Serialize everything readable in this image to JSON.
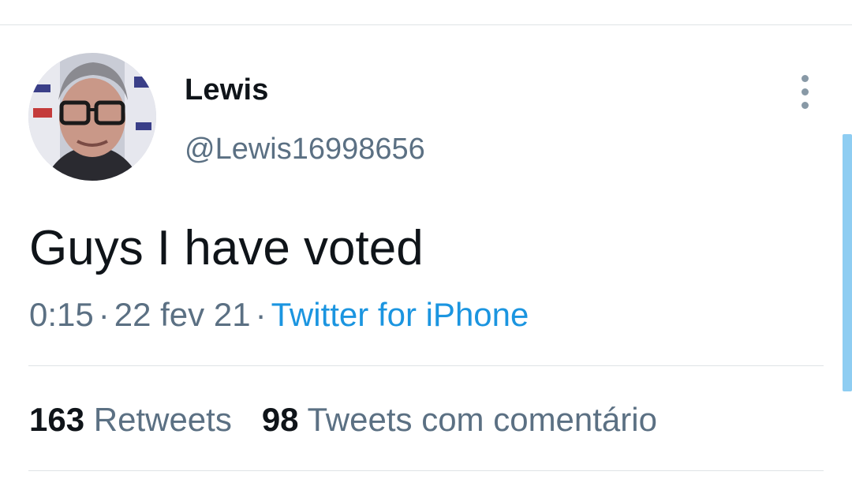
{
  "tweet": {
    "author": {
      "display_name": "Lewis",
      "handle": "@Lewis16998656",
      "avatar_icon": "profile-photo-man-glasses"
    },
    "text": "Guys I have voted",
    "time": "0:15",
    "date": "22 fev 21",
    "separator": "·",
    "source": "Twitter for iPhone",
    "more_icon": "vertical-ellipsis-icon"
  },
  "stats": {
    "retweets_count": "163",
    "retweets_label": "Retweets",
    "quotes_count": "98",
    "quotes_label": "Tweets com comentário"
  },
  "colors": {
    "text_primary": "#0f1419",
    "text_secondary": "#5b7083",
    "link": "#1b95e0",
    "divider": "#dfe3e6",
    "scrollbar": "#8ecdf2"
  }
}
